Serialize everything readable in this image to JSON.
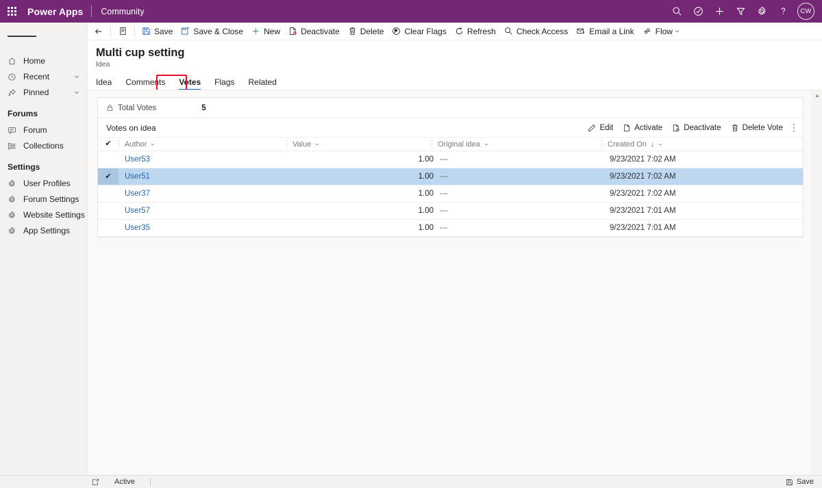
{
  "appbar": {
    "waffle_icon": "waffle-grid-icon",
    "brand": "Power Apps",
    "app_name": "Community",
    "icons": [
      {
        "name": "search-icon",
        "label": "Search"
      },
      {
        "name": "check-circle-icon",
        "label": "Assistant"
      },
      {
        "name": "plus-icon",
        "label": "Quick create"
      },
      {
        "name": "filter-icon",
        "label": "Filter"
      },
      {
        "name": "gear-icon",
        "label": "Settings"
      },
      {
        "name": "help-icon",
        "label": "Help"
      }
    ],
    "avatar_initials": "CW"
  },
  "sidebar": {
    "hamburger_label": "Expand navigation",
    "items": [
      {
        "label": "Home",
        "icon": "home-icon",
        "chevron": false
      },
      {
        "label": "Recent",
        "icon": "clock-icon",
        "chevron": true
      },
      {
        "label": "Pinned",
        "icon": "pin-icon",
        "chevron": true
      }
    ],
    "groups": [
      {
        "title": "Forums",
        "items": [
          {
            "label": "Forum",
            "icon": "forum-icon"
          },
          {
            "label": "Collections",
            "icon": "list-icon"
          }
        ]
      },
      {
        "title": "Settings",
        "items": [
          {
            "label": "User Profiles",
            "icon": "gear-icon"
          },
          {
            "label": "Forum Settings",
            "icon": "gear-icon"
          },
          {
            "label": "Website Settings",
            "icon": "gear-icon"
          },
          {
            "label": "App Settings",
            "icon": "gear-icon"
          }
        ]
      }
    ]
  },
  "commandbar": {
    "back_icon": "back-arrow-icon",
    "form_selector_icon": "form-icon",
    "commands": [
      {
        "label": "Save",
        "icon": "save-icon"
      },
      {
        "label": "Save & Close",
        "icon": "save-close-icon"
      },
      {
        "label": "New",
        "icon": "plus-icon"
      },
      {
        "label": "Deactivate",
        "icon": "deactivate-icon"
      },
      {
        "label": "Delete",
        "icon": "trash-icon"
      },
      {
        "label": "Clear Flags",
        "icon": "clear-flags-icon"
      },
      {
        "label": "Refresh",
        "icon": "refresh-icon"
      },
      {
        "label": "Check Access",
        "icon": "check-access-icon"
      },
      {
        "label": "Email a Link",
        "icon": "email-icon"
      },
      {
        "label": "Flow",
        "icon": "flow-icon",
        "caret": true
      }
    ]
  },
  "record": {
    "title": "Multi cup setting",
    "entity": "Idea"
  },
  "tabs": [
    {
      "label": "Idea",
      "active": false
    },
    {
      "label": "Comments",
      "active": false
    },
    {
      "label": "Votes",
      "active": true,
      "annotated": true
    },
    {
      "label": "Flags",
      "active": false
    },
    {
      "label": "Related",
      "active": false
    }
  ],
  "totals": {
    "lock_icon": "lock-icon",
    "label": "Total Votes",
    "value": "5"
  },
  "subgrid": {
    "title": "Votes on idea",
    "commands": [
      {
        "label": "Edit",
        "icon": "pencil-icon"
      },
      {
        "label": "Activate",
        "icon": "activate-icon"
      },
      {
        "label": "Deactivate",
        "icon": "deactivate-icon"
      },
      {
        "label": "Delete Vote",
        "icon": "trash-icon"
      }
    ],
    "more_icon": "more-vertical-icon",
    "columns": [
      {
        "label": "Author",
        "sorted": false
      },
      {
        "label": "Value",
        "sorted": false
      },
      {
        "label": "Original idea",
        "sorted": false
      },
      {
        "label": "Created On",
        "sorted": true,
        "sort_dir": "↓"
      }
    ],
    "select_all_icon": "checkmark-icon",
    "rows": [
      {
        "selected": false,
        "author": "User53",
        "value": "1.00",
        "original_idea": "---",
        "created_on": "9/23/2021 7:02 AM"
      },
      {
        "selected": true,
        "author": "User51",
        "value": "1.00",
        "original_idea": "---",
        "created_on": "9/23/2021 7:02 AM"
      },
      {
        "selected": false,
        "author": "User37",
        "value": "1.00",
        "original_idea": "---",
        "created_on": "9/23/2021 7:02 AM"
      },
      {
        "selected": false,
        "author": "User57",
        "value": "1.00",
        "original_idea": "---",
        "created_on": "9/23/2021 7:01 AM"
      },
      {
        "selected": false,
        "author": "User35",
        "value": "1.00",
        "original_idea": "---",
        "created_on": "9/23/2021 7:01 AM"
      }
    ]
  },
  "statusbar": {
    "state_icon": "record-state-icon",
    "state": "Active",
    "save_label": "Save",
    "save_icon": "save-icon"
  },
  "colors": {
    "brand_purple": "#742774",
    "tab_accent": "#2266e3",
    "annotation_red": "#e8112d",
    "link_blue": "#2266b3",
    "row_selected": "#bcd7ef"
  }
}
